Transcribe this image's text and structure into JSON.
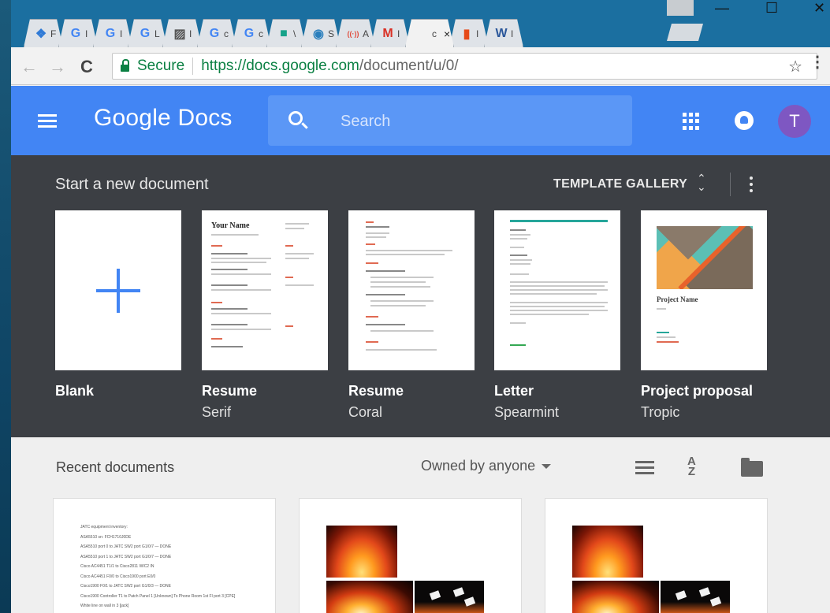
{
  "browser": {
    "tabs": [
      {
        "icon": "dropbox-icon",
        "title": "F",
        "color": "#2f7ad6",
        "glyph": "❖"
      },
      {
        "icon": "google-icon",
        "title": "I",
        "color": "#4285f4",
        "glyph": "G"
      },
      {
        "icon": "google-icon",
        "title": "I",
        "color": "#4285f4",
        "glyph": "G"
      },
      {
        "icon": "google-icon",
        "title": "L",
        "color": "#4285f4",
        "glyph": "G"
      },
      {
        "icon": "image-icon",
        "title": "I",
        "color": "#555555",
        "glyph": "▨"
      },
      {
        "icon": "google-icon",
        "title": "c",
        "color": "#4285f4",
        "glyph": "G"
      },
      {
        "icon": "google-icon",
        "title": "c",
        "color": "#4285f4",
        "glyph": "G"
      },
      {
        "icon": "teal-square-icon",
        "title": "\\",
        "color": "#16a38a",
        "glyph": "■"
      },
      {
        "icon": "dell-icon",
        "title": "S",
        "color": "#2a7fbd",
        "glyph": "◉"
      },
      {
        "icon": "wifi-icon",
        "title": "A",
        "color": "#e04a3a",
        "glyph": "((·))"
      },
      {
        "icon": "gmail-icon",
        "title": "I",
        "color": "#d93025",
        "glyph": "M"
      },
      {
        "icon": "cisco-icon",
        "title": "c",
        "color": "#555555",
        "glyph": "",
        "active": true
      },
      {
        "icon": "office-icon",
        "title": "I",
        "color": "#e64a19",
        "glyph": "▮"
      },
      {
        "icon": "word-icon",
        "title": "I",
        "color": "#2b579a",
        "glyph": "W"
      }
    ],
    "active_tab_close": "×",
    "secure_label": "Secure",
    "url_host": "https://docs.google.com",
    "url_path": "/document/u/0/",
    "star": "☆",
    "menu": "⋮",
    "back": "←",
    "forward": "→",
    "reload": "C",
    "minimize": "—",
    "maximize": "☐",
    "close": "✕"
  },
  "header": {
    "title": "Google Docs",
    "search_placeholder": "Search",
    "avatar_letter": "T"
  },
  "templates": {
    "section_title": "Start a new document",
    "gallery_label": "TEMPLATE GALLERY",
    "items": [
      {
        "name": "Blank",
        "sub": ""
      },
      {
        "name": "Resume",
        "sub": "Serif"
      },
      {
        "name": "Resume",
        "sub": "Coral"
      },
      {
        "name": "Letter",
        "sub": "Spearmint"
      },
      {
        "name": "Project proposal",
        "sub": "Tropic"
      }
    ],
    "serif_thumb_name": "Your Name",
    "tropic_thumb_name": "Project Name"
  },
  "recent": {
    "title": "Recent documents",
    "owner_filter": "Owned by anyone",
    "doc1_lines": [
      "JATC equipment inventory:",
      "ASA5510 sn: FCH1710J0DE",
      "ASA5510 port 0 to JATC SW2 port G1/0/7 — DONE",
      "ASA5510 port 1 to JATC SW2 port G1/0/7 — DONE",
      "Cisco AC4451 T1/1 to Cisco2811 WIC2 IN",
      "Cisco AC4451 F0/0 to Cisco1900 port E0/0",
      "Cisco1900 F0/1 to JATC SW2 port G1/0/3 — DONE",
      "Cisco1900 Controller T1 to Patch Panel 1 [Unknown] To Phone Room 1st Fl port 3 [CPE]",
      "White line on wall in 3 [jack]"
    ]
  },
  "colors": {
    "docs_blue": "#4285f4",
    "template_bg": "#3c3f44",
    "secure_green": "#0b8043",
    "avatar_purple": "#7e57c2"
  }
}
